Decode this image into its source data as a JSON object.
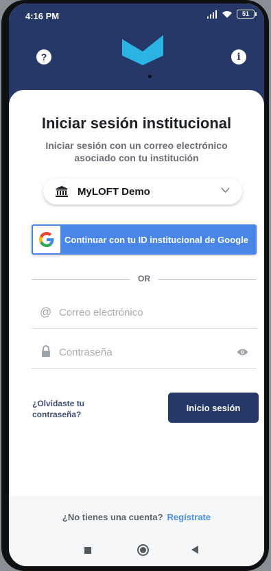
{
  "status_bar": {
    "time": "4:16 PM",
    "battery": "51"
  },
  "header": {
    "help_icon": "?",
    "info_icon": "i",
    "logo": "myloft-logo"
  },
  "login": {
    "title": "Iniciar sesión institucional",
    "subtitle": "Iniciar sesión con un correo electrónico asociado con tu institución",
    "institution": "MyLOFT Demo",
    "google_button": "Continuar con tu ID institucional de Google",
    "separator": "OR",
    "email_placeholder": "Correo electrónico",
    "email_icon": "@",
    "password_placeholder": "Contraseña",
    "forgot_password": "¿Olvidaste tu contraseña?",
    "login_button": "Inicio sesión"
  },
  "footer": {
    "question": "¿No tienes una cuenta?",
    "register_link": "Regístrate"
  },
  "colors": {
    "primary": "#253868",
    "google_blue": "#4A86E8",
    "logo_cyan": "#2BB3E3",
    "link": "#4B8EE8"
  }
}
